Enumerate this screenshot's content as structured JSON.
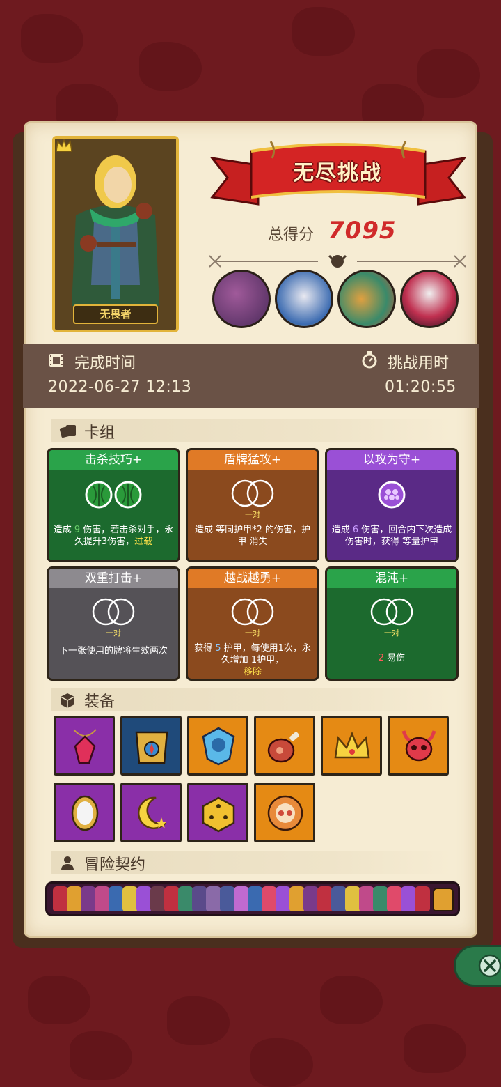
{
  "hero": {
    "name": "无畏者"
  },
  "header": {
    "banner_title": "无尽挑战",
    "score_label": "总得分",
    "score_value": "7095"
  },
  "time": {
    "finish_label": "完成时间",
    "finish_value": "2022-06-27  12:13",
    "duration_label": "挑战用时",
    "duration_value": "01:20:55"
  },
  "sections": {
    "deck": "卡组",
    "equipment": "装备",
    "contract": "冒险契约"
  },
  "cards": [
    {
      "title": "击杀技巧+",
      "pair": "",
      "desc_a": "造成 ",
      "val": "9",
      "desc_b": " 伤害，若击杀对手，永久提升3伤害，",
      "tail": "过载"
    },
    {
      "title": "盾牌猛攻+",
      "pair": "一对",
      "desc_a": "造成  等同",
      "val": "",
      "desc_b": "护甲*2 的伤害，",
      "tail": "护甲 消失"
    },
    {
      "title": "以攻为守+",
      "pair": "",
      "desc_a": "造成 ",
      "val": "6",
      "desc_b": " 伤害，回合内下次造成伤害时，获得  等量",
      "tail": "护甲"
    },
    {
      "title": "双重打击+",
      "pair": "一对",
      "desc_a": "下一张使用的牌将生效两次",
      "val": "",
      "desc_b": "",
      "tail": ""
    },
    {
      "title": "越战越勇+",
      "pair": "一对",
      "desc_a": "获得 ",
      "val": "5",
      "desc_b": " 护甲，每使用1次，永久增加 ",
      "tail": "1护甲，",
      "tail2": "移除"
    },
    {
      "title": "混沌+",
      "pair": "一对",
      "desc_a": "",
      "val": "2",
      "desc_b": " 易伤",
      "tail": ""
    }
  ],
  "colors": {
    "background": "#6e1a1f",
    "panel": "#f6ecd3",
    "score": "#d02a2a",
    "time_bar": "#6a5246"
  },
  "icons": {
    "close": "close-icon",
    "film": "film-icon",
    "stopwatch": "stopwatch-icon"
  }
}
